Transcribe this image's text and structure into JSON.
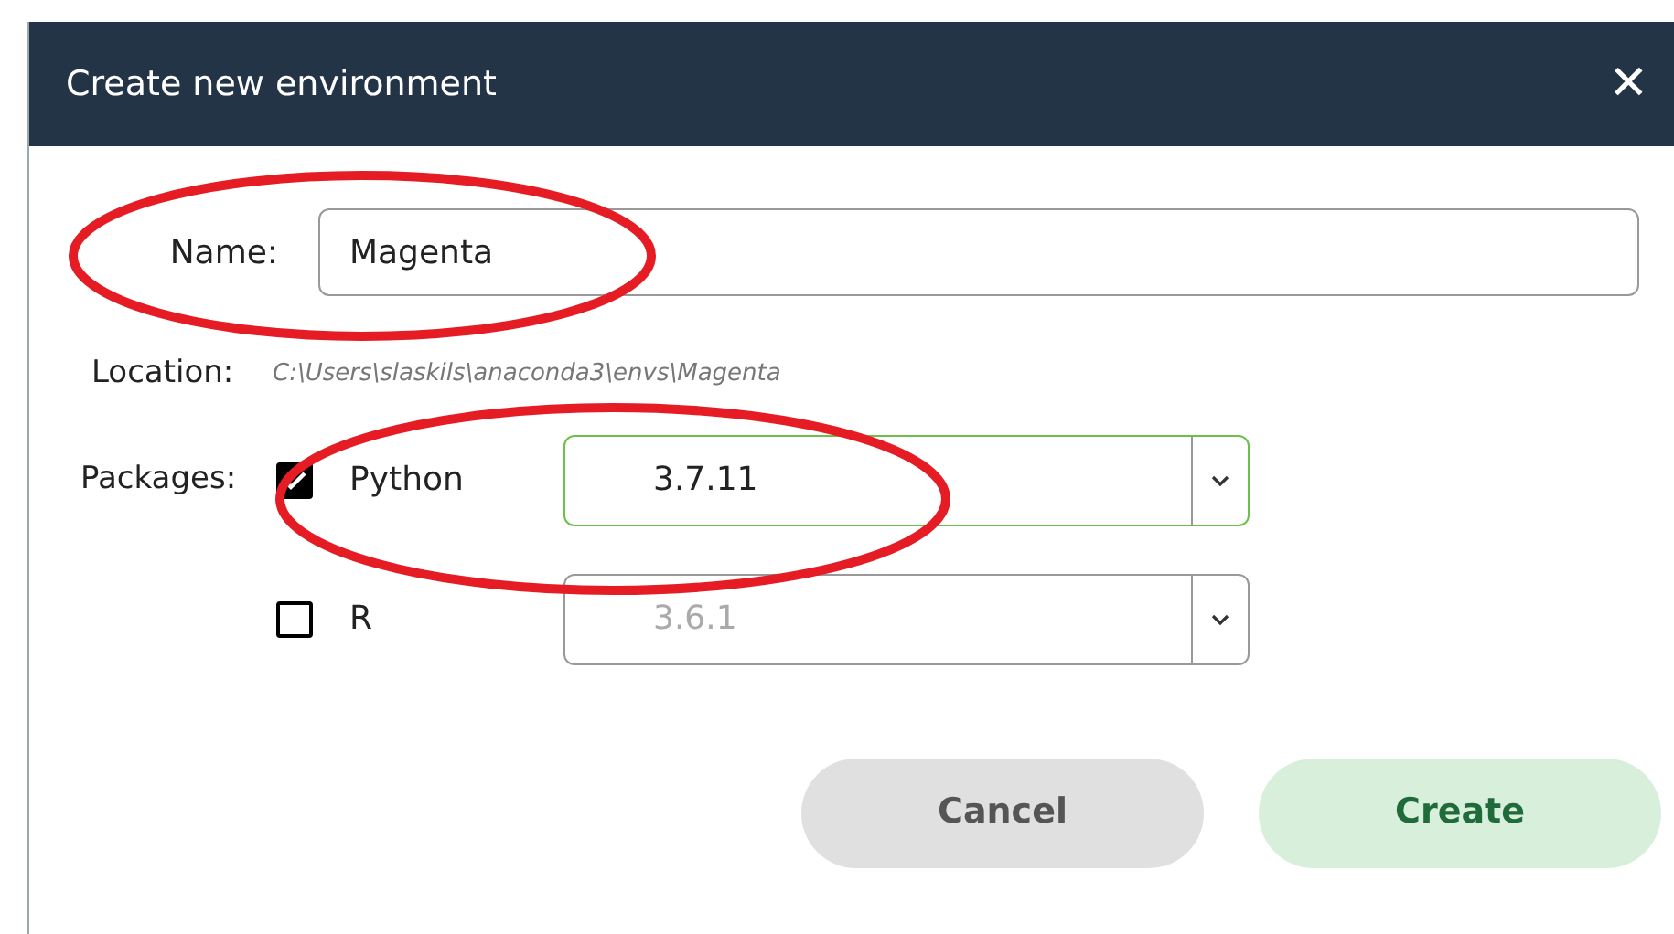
{
  "dialog": {
    "title": "Create new environment",
    "close": "✕"
  },
  "name": {
    "label": "Name:",
    "value": "Magenta"
  },
  "location": {
    "label": "Location:",
    "value": "C:\\Users\\slaskils\\anaconda3\\envs\\Magenta"
  },
  "packages": {
    "label": "Packages:",
    "items": [
      {
        "label": "Python",
        "checked": true,
        "version": "3.7.11",
        "focused": true,
        "disabled": false
      },
      {
        "label": "R",
        "checked": false,
        "version": "3.6.1",
        "focused": false,
        "disabled": true
      }
    ]
  },
  "buttons": [
    {
      "label": "Cancel",
      "kind": "secondary"
    },
    {
      "label": "Create",
      "kind": "primary"
    }
  ]
}
